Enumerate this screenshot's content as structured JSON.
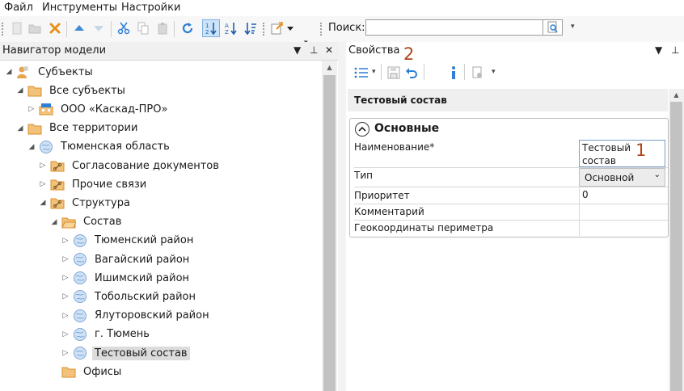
{
  "menu": {
    "file": "Файл",
    "tools": "Инструменты",
    "settings": "Настройки"
  },
  "toolbar": {
    "search_label": "Поиск:",
    "search_value": ""
  },
  "navigator": {
    "title": "Навигатор модели",
    "tree": [
      {
        "label": "Субъекты",
        "level": 0,
        "expander": "expanded",
        "icon": "people-icon"
      },
      {
        "label": "Все субъекты",
        "level": 1,
        "expander": "expanded",
        "icon": "folder-icon"
      },
      {
        "label": "ООО «Каскад-ПРО»",
        "level": 2,
        "expander": "collapsed",
        "icon": "building-icon"
      },
      {
        "label": "Все территории",
        "level": 1,
        "expander": "expanded",
        "icon": "folder-icon"
      },
      {
        "label": "Тюменская область",
        "level": 2,
        "expander": "expanded",
        "icon": "globe-icon"
      },
      {
        "label": "Согласование документов",
        "level": 3,
        "expander": "collapsed",
        "icon": "folder-link-icon"
      },
      {
        "label": "Прочие связи",
        "level": 3,
        "expander": "collapsed",
        "icon": "folder-link-icon"
      },
      {
        "label": "Структура",
        "level": 3,
        "expander": "expanded",
        "icon": "folder-link-icon"
      },
      {
        "label": "Состав",
        "level": 4,
        "expander": "expanded",
        "icon": "folder-open-icon"
      },
      {
        "label": "Тюменский район",
        "level": 5,
        "expander": "collapsed",
        "icon": "globe-icon"
      },
      {
        "label": "Вагайский район",
        "level": 5,
        "expander": "collapsed",
        "icon": "globe-icon"
      },
      {
        "label": "Ишимский район",
        "level": 5,
        "expander": "collapsed",
        "icon": "globe-icon"
      },
      {
        "label": "Тобольский район",
        "level": 5,
        "expander": "collapsed",
        "icon": "globe-icon"
      },
      {
        "label": "Ялуторовский район",
        "level": 5,
        "expander": "collapsed",
        "icon": "globe-icon"
      },
      {
        "label": "г. Тюмень",
        "level": 5,
        "expander": "collapsed",
        "icon": "globe-icon"
      },
      {
        "label": "Тестовый состав",
        "level": 5,
        "expander": "collapsed",
        "icon": "globe-icon",
        "selected": true
      },
      {
        "label": "Офисы",
        "level": 4,
        "expander": "none",
        "icon": "folder-icon"
      }
    ]
  },
  "properties": {
    "title": "Свойства",
    "object_title": "Тестовый состав",
    "group_title": "Основные",
    "rows": [
      {
        "name": "Наименование*",
        "value": "Тестовый состав"
      },
      {
        "name": "Тип",
        "value": "Основной"
      },
      {
        "name": "Приоритет",
        "value": "0"
      },
      {
        "name": "Комментарий",
        "value": ""
      },
      {
        "name": "Геокоординаты периметра",
        "value": ""
      }
    ]
  },
  "annotations": {
    "marker_1": "1",
    "marker_2": "2"
  },
  "colors": {
    "accent_blue": "#2f7fd6",
    "folder": "#e8a54b",
    "annotation": "#b0461a",
    "selection": "#dcdcdc"
  }
}
